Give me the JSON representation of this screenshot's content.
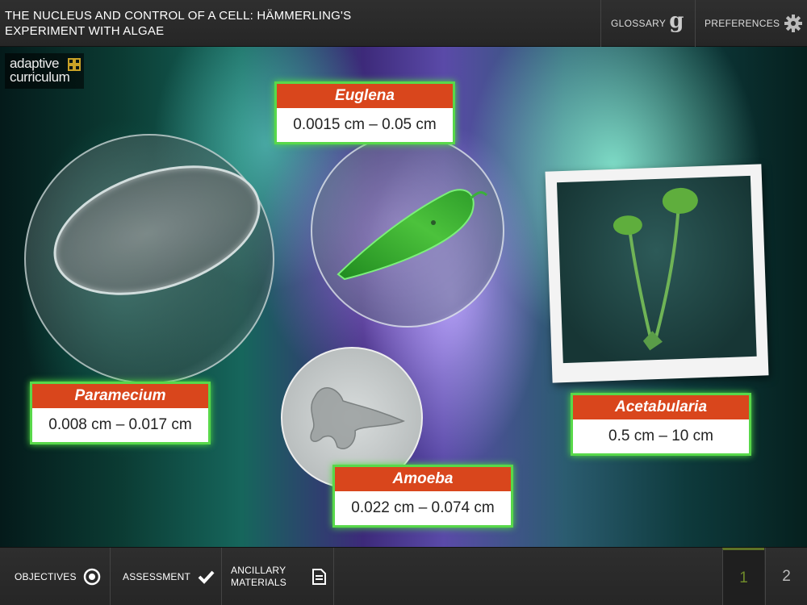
{
  "header": {
    "title": "THE NUCLEUS AND CONTROL OF A CELL: HÄMMERLING'S EXPERIMENT WITH ALGAE",
    "glossary_label": "GLOSSARY",
    "glossary_glyph": "g",
    "preferences_label": "PREFERENCES"
  },
  "logo": {
    "line1": "adaptive",
    "line2": "curriculum"
  },
  "organisms": {
    "euglena": {
      "name": "Euglena",
      "size": "0.0015 cm – 0.05 cm"
    },
    "paramecium": {
      "name": "Paramecium",
      "size": "0.008 cm – 0.017 cm"
    },
    "amoeba": {
      "name": "Amoeba",
      "size": "0.022 cm – 0.074 cm"
    },
    "acetabularia": {
      "name": "Acetabularia",
      "size": "0.5 cm – 10 cm"
    }
  },
  "footer": {
    "objectives_label": "OBJECTIVES",
    "assessment_label": "ASSESSMENT",
    "ancillary_line1": "ANCILLARY",
    "ancillary_line2": "MATERIALS",
    "pages": [
      "1",
      "2"
    ],
    "current_page": "1"
  },
  "colors": {
    "label_header": "#d9461c",
    "label_glow": "#58d84a",
    "active_page": "#6f8a2a"
  }
}
